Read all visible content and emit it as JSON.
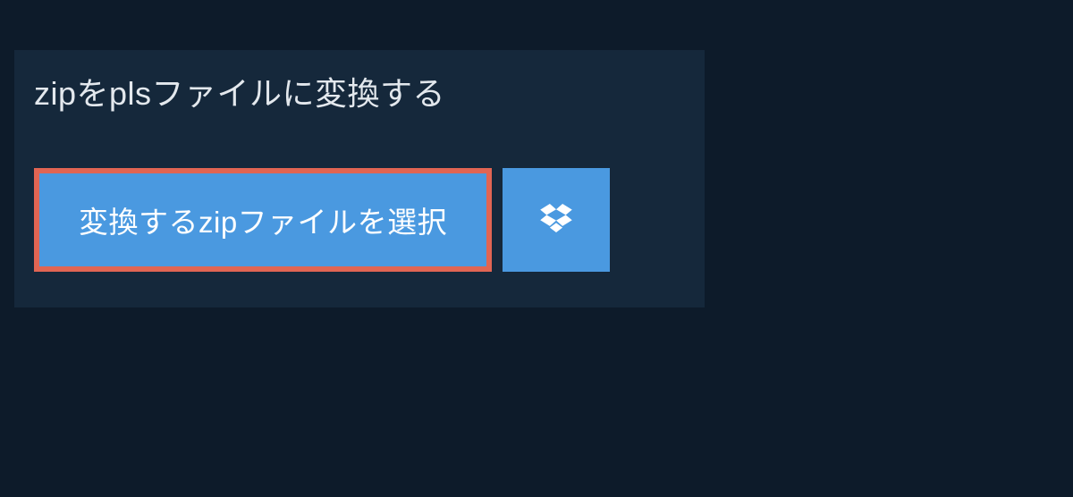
{
  "title": "zipをplsファイルに変換する",
  "buttons": {
    "select_label": "変換するzipファイルを選択"
  },
  "colors": {
    "background": "#0d1b2a",
    "panel": "#15283b",
    "button_bg": "#4a99e0",
    "button_border": "#e16553",
    "text_light": "#e3e8ed"
  }
}
